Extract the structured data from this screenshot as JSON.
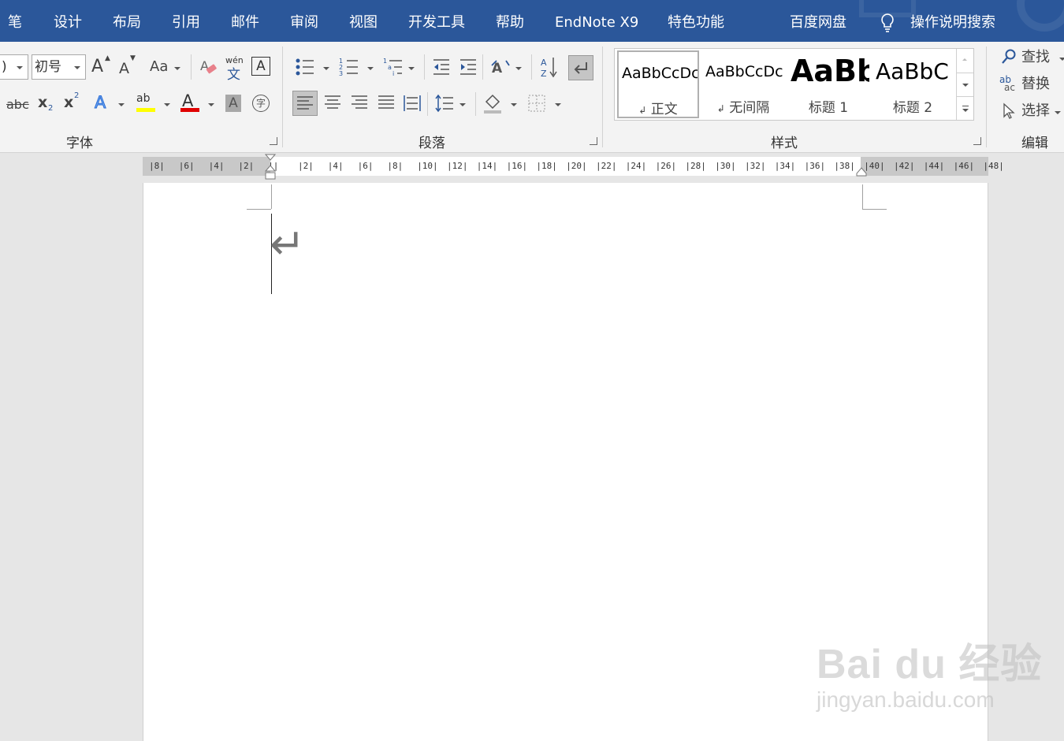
{
  "tabs": [
    "笔",
    "设计",
    "布局",
    "引用",
    "邮件",
    "审阅",
    "视图",
    "开发工具",
    "帮助",
    "EndNote X9",
    "特色功能",
    "百度网盘"
  ],
  "tell_me": "操作说明搜索",
  "font": {
    "name_value": ")",
    "size_value": "初号",
    "grow_label": "A",
    "shrink_label": "A",
    "case_label": "Aa",
    "phonetic_top": "wén",
    "phonetic_bottom": "文",
    "border_char": "A",
    "strike_label": "abc",
    "sub_label": "x",
    "sub_mark": "2",
    "sup_label": "x",
    "sup_mark": "2",
    "effects_label": "A",
    "highlight_label": "ab",
    "color_label": "A",
    "shade_char": "A",
    "enclose_char": "字",
    "group_label": "字体"
  },
  "paragraph": {
    "group_label": "段落"
  },
  "styles": {
    "group_label": "样式",
    "items": [
      {
        "sample": "AaBbCcDc",
        "name": "正文",
        "mark": "↲"
      },
      {
        "sample": "AaBbCcDc",
        "name": "无间隔",
        "mark": "↲"
      },
      {
        "sample": "AaBb",
        "name": "标题 1",
        "mark": ""
      },
      {
        "sample": "AaBbC",
        "name": "标题 2",
        "mark": ""
      }
    ]
  },
  "editing": {
    "group_label": "编辑",
    "find": "查找",
    "replace": "替换",
    "select": "选择",
    "replace_icon_top": "ab",
    "replace_icon_bottom": "ac"
  },
  "ruler": [
    "8",
    "6",
    "4",
    "2",
    "",
    "2",
    "4",
    "6",
    "8",
    "10",
    "12",
    "14",
    "16",
    "18",
    "20",
    "22",
    "24",
    "26",
    "28",
    "30",
    "32",
    "34",
    "36",
    "38",
    "40",
    "42",
    "44",
    "46",
    "48"
  ],
  "document": {
    "para_mark": "↵"
  },
  "watermark": {
    "logo": "Bai du 经验",
    "url": "jingyan.baidu.com"
  },
  "colors": {
    "tab_bar": "#2b579a",
    "ribbon": "#f3f3f3",
    "highlight": "#ffff00",
    "font_color": "#e00000"
  }
}
